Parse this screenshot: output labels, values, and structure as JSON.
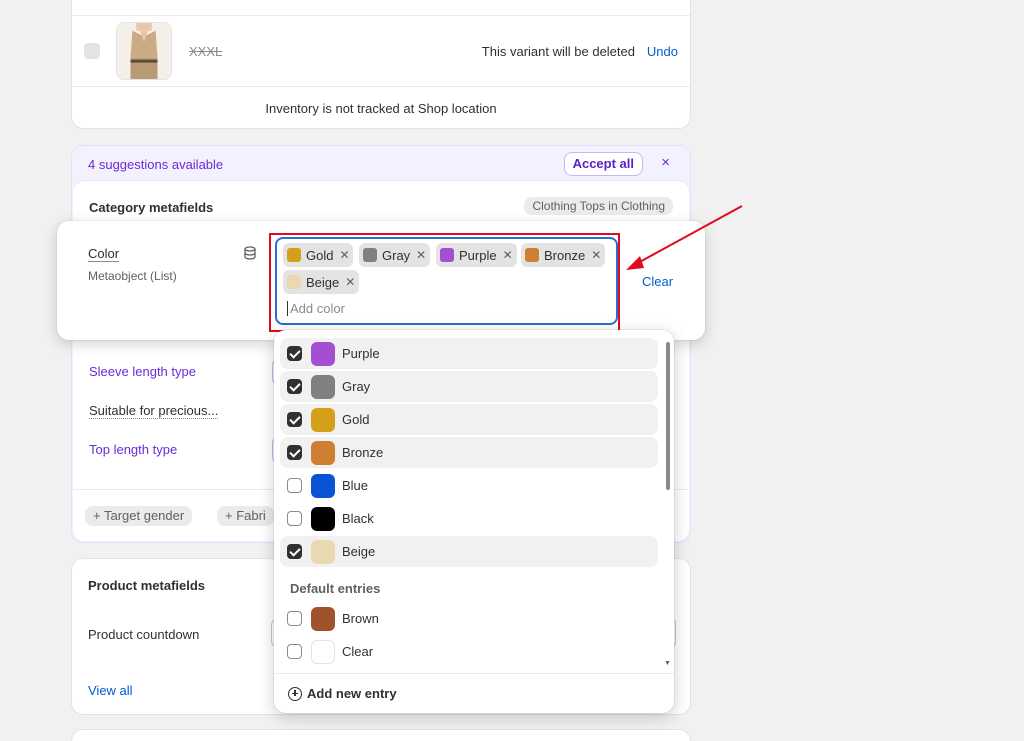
{
  "variants": {
    "variant_name": "XXXL",
    "deleted_note": "This variant will be deleted",
    "undo_label": "Undo",
    "inventory_note": "Inventory is not tracked at Shop location"
  },
  "suggestions": {
    "count_label": "4 suggestions available",
    "accept_all_label": "Accept all",
    "close_icon": "×",
    "category_title": "Category metafields",
    "category_badge": "Clothing Tops in Clothing",
    "rows": [
      {
        "label": "Sleeve length type"
      },
      {
        "label": "Suitable for precious..."
      },
      {
        "label": "Top length type"
      }
    ],
    "chips": [
      "+ Target gender",
      "+ Fabri"
    ]
  },
  "color_field": {
    "label": "Color",
    "sublabel": "Metaobject (List)",
    "icon": "database-icon",
    "clear_label": "Clear",
    "placeholder": "Add color",
    "tags": [
      {
        "name": "Gold",
        "color": "#d4a01a"
      },
      {
        "name": "Gray",
        "color": "#808080"
      },
      {
        "name": "Purple",
        "color": "#a44fd1"
      },
      {
        "name": "Bronze",
        "color": "#cd7f32"
      },
      {
        "name": "Beige",
        "color": "#ead8b1"
      }
    ]
  },
  "dropdown": {
    "options": [
      {
        "name": "Purple",
        "color": "#a44fd1",
        "checked": true
      },
      {
        "name": "Gray",
        "color": "#808080",
        "checked": true
      },
      {
        "name": "Gold",
        "color": "#d4a01a",
        "checked": true
      },
      {
        "name": "Bronze",
        "color": "#cd7f32",
        "checked": true
      },
      {
        "name": "Blue",
        "color": "#0a53d5",
        "checked": false
      },
      {
        "name": "Black",
        "color": "#000000",
        "checked": false
      },
      {
        "name": "Beige",
        "color": "#ead8b1",
        "checked": true
      }
    ],
    "section_label": "Default entries",
    "default_options": [
      {
        "name": "Brown",
        "color": "#a0522d",
        "checked": false
      },
      {
        "name": "Clear",
        "color": "#ffffff",
        "checked": false
      }
    ],
    "add_entry_label": "Add new entry"
  },
  "product_metafields": {
    "title": "Product metafields",
    "countdown_label": "Product countdown",
    "view_all_label": "View all"
  },
  "annotation": {
    "highlight_color": "#e00b1c"
  }
}
